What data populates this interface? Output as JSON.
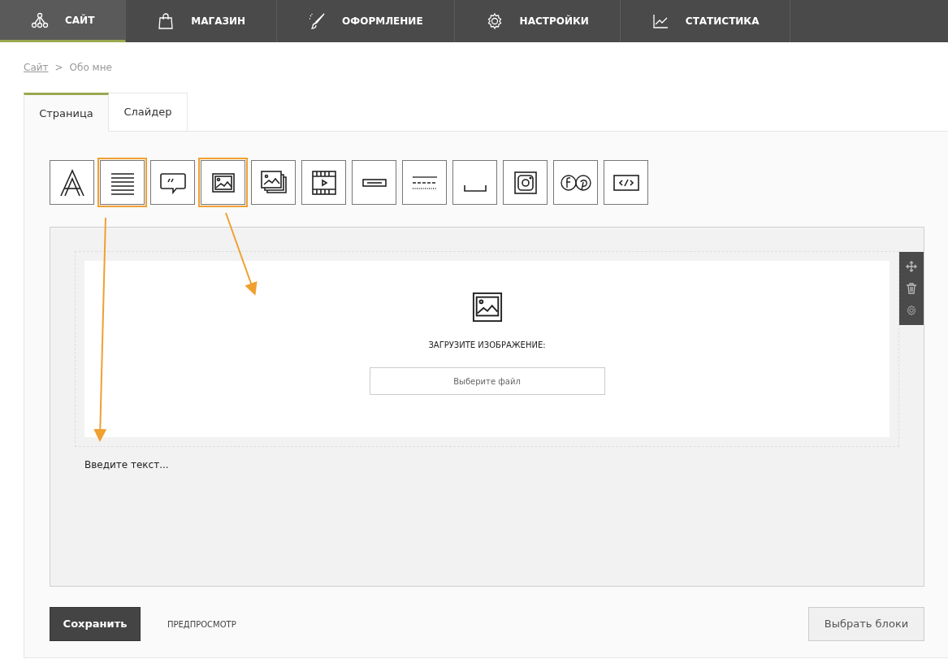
{
  "nav": [
    {
      "label": "САЙТ",
      "selected": true
    },
    {
      "label": "МАГАЗИН",
      "selected": false
    },
    {
      "label": "ОФОРМЛЕНИЕ",
      "selected": false
    },
    {
      "label": "НАСТРОЙКИ",
      "selected": false
    },
    {
      "label": "СТАТИСТИКА",
      "selected": false
    }
  ],
  "breadcrumb": {
    "link": "Сайт",
    "separator": ">",
    "current": "Обо мне"
  },
  "tabs": [
    {
      "label": "Страница",
      "selected": true
    },
    {
      "label": "Слайдер",
      "selected": false
    }
  ],
  "blocks": [
    {
      "kind": "heading",
      "highlighted": false
    },
    {
      "kind": "text",
      "highlighted": true
    },
    {
      "kind": "quote",
      "highlighted": false
    },
    {
      "kind": "image",
      "highlighted": true
    },
    {
      "kind": "gallery",
      "highlighted": false
    },
    {
      "kind": "video",
      "highlighted": false
    },
    {
      "kind": "button",
      "highlighted": false
    },
    {
      "kind": "divider",
      "highlighted": false
    },
    {
      "kind": "spacer",
      "highlighted": false
    },
    {
      "kind": "instagram",
      "highlighted": false
    },
    {
      "kind": "social",
      "highlighted": false
    },
    {
      "kind": "code",
      "highlighted": false
    }
  ],
  "image_block": {
    "heading": "ЗАГРУЗИТЕ ИЗОБРАЖЕНИЕ:",
    "file_button": "Выберите файл"
  },
  "text_block": {
    "placeholder": "Введите текст..."
  },
  "actions": {
    "save": "Сохранить",
    "preview": "ПРЕДПРОСМОТР",
    "choose_blocks": "Выбрать блоки"
  }
}
